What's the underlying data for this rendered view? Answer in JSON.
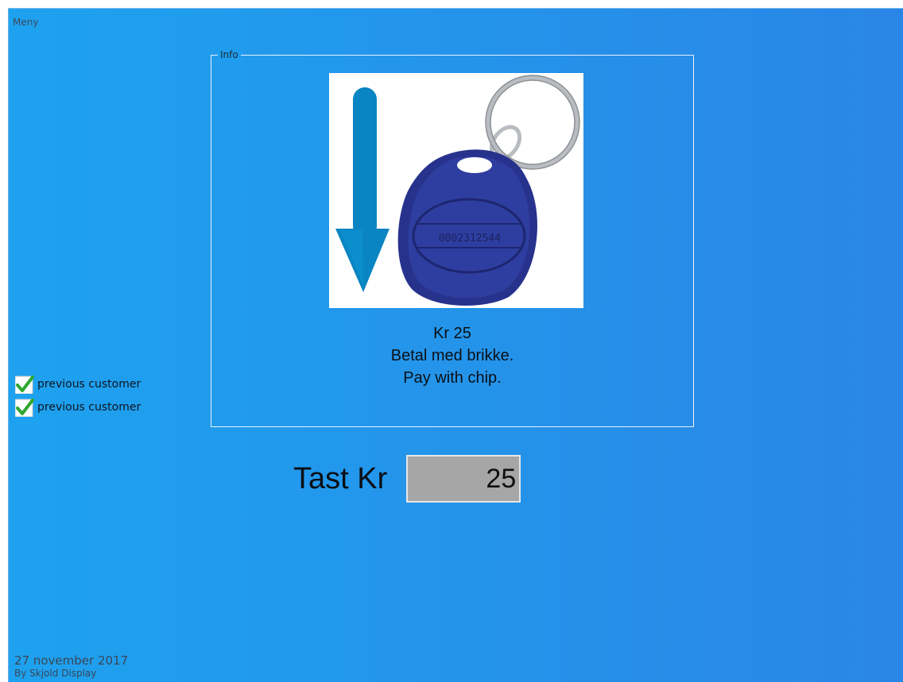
{
  "menu": {
    "label": "Meny"
  },
  "info": {
    "legend": "Info",
    "price_line": "Kr 25",
    "line_no": "Betal med brikke.",
    "line_en": "Pay with chip.",
    "image": {
      "tag_number": "0002312544",
      "accent_color": "#0a84c2",
      "tag_color": "#27328c"
    }
  },
  "customers": {
    "items": [
      {
        "label": "previous customer",
        "icon": "check-icon"
      },
      {
        "label": "previous customer",
        "icon": "check-icon"
      }
    ]
  },
  "amount": {
    "label": "Tast Kr",
    "value": "25"
  },
  "footer": {
    "date": "27 november 2017",
    "credit": "By Skjold Display"
  },
  "colors": {
    "background_start": "#1ea2ef",
    "background_end": "#2a86e6",
    "input_bg": "#a6a6a6"
  }
}
